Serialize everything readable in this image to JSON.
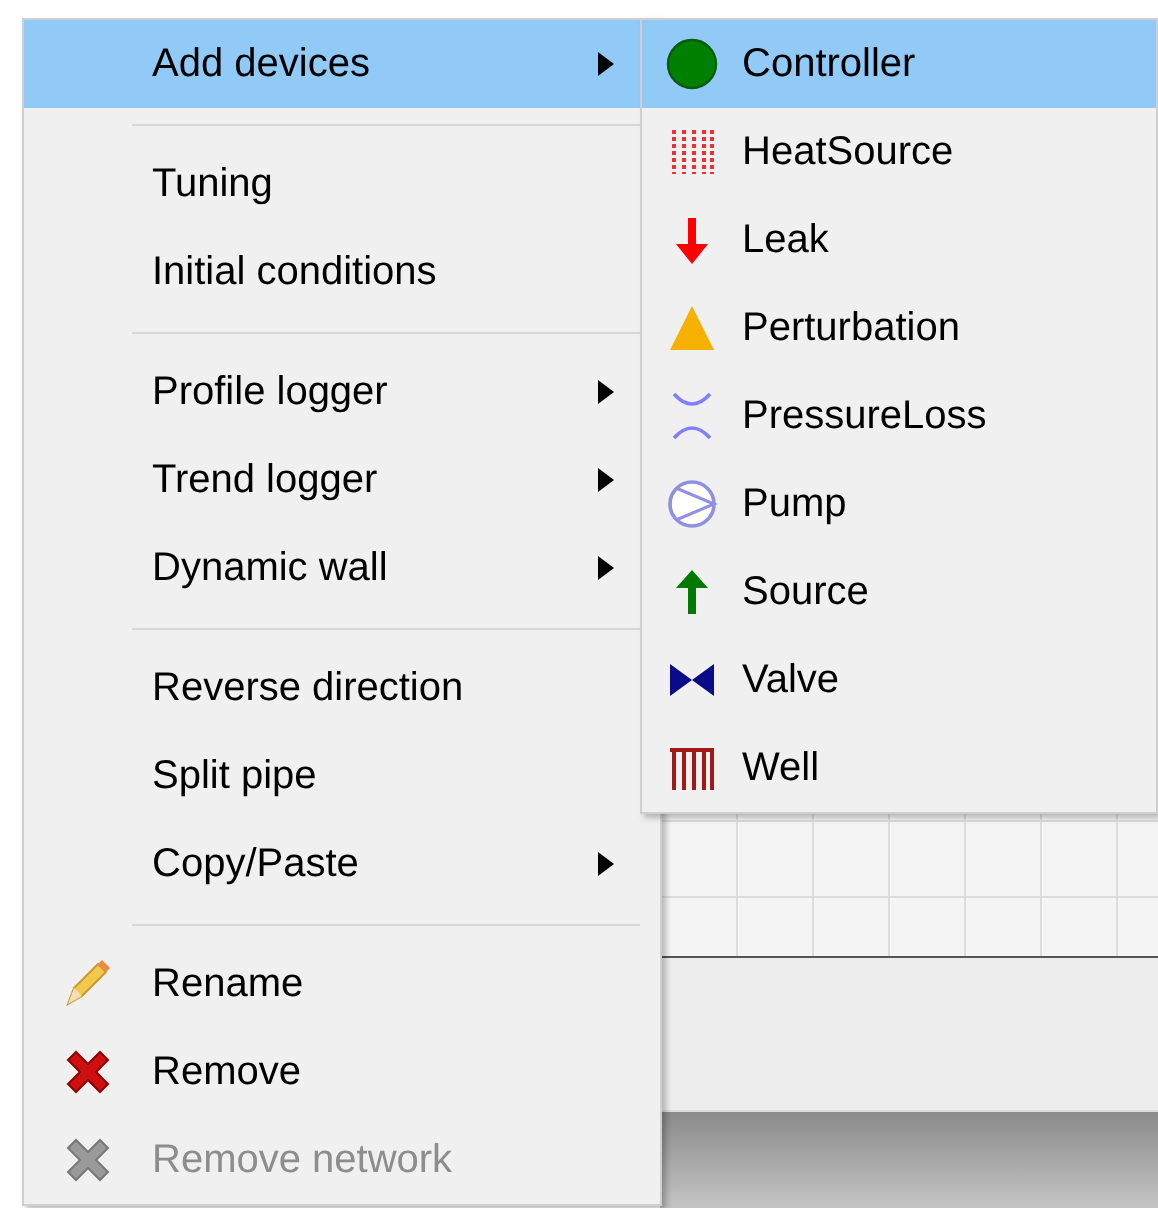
{
  "context_menu": {
    "items": [
      {
        "kind": "item",
        "label": "Add devices",
        "selected": true,
        "has_submenu": true,
        "disabled": false
      },
      {
        "kind": "separator"
      },
      {
        "kind": "item",
        "label": "Tuning",
        "selected": false,
        "has_submenu": false,
        "disabled": false
      },
      {
        "kind": "item",
        "label": "Initial conditions",
        "selected": false,
        "has_submenu": false,
        "disabled": false
      },
      {
        "kind": "separator"
      },
      {
        "kind": "item",
        "label": "Profile logger",
        "selected": false,
        "has_submenu": true,
        "disabled": false
      },
      {
        "kind": "item",
        "label": "Trend logger",
        "selected": false,
        "has_submenu": true,
        "disabled": false
      },
      {
        "kind": "item",
        "label": "Dynamic wall",
        "selected": false,
        "has_submenu": true,
        "disabled": false
      },
      {
        "kind": "separator"
      },
      {
        "kind": "item",
        "label": "Reverse direction",
        "selected": false,
        "has_submenu": false,
        "disabled": false
      },
      {
        "kind": "item",
        "label": "Split pipe",
        "selected": false,
        "has_submenu": false,
        "disabled": false
      },
      {
        "kind": "item",
        "label": "Copy/Paste",
        "selected": false,
        "has_submenu": true,
        "disabled": false
      },
      {
        "kind": "separator"
      },
      {
        "kind": "item",
        "label": "Rename",
        "selected": false,
        "has_submenu": false,
        "disabled": false
      },
      {
        "kind": "item",
        "label": "Remove",
        "selected": false,
        "has_submenu": false,
        "disabled": false
      },
      {
        "kind": "item",
        "label": "Remove network",
        "selected": false,
        "has_submenu": false,
        "disabled": true
      }
    ]
  },
  "devices_submenu": {
    "items": [
      {
        "kind": "item",
        "label": "Controller",
        "selected": true
      },
      {
        "kind": "item",
        "label": "HeatSource",
        "selected": false
      },
      {
        "kind": "item",
        "label": "Leak",
        "selected": false
      },
      {
        "kind": "item",
        "label": "Perturbation",
        "selected": false
      },
      {
        "kind": "item",
        "label": "PressureLoss",
        "selected": false
      },
      {
        "kind": "item",
        "label": "Pump",
        "selected": false
      },
      {
        "kind": "item",
        "label": "Source",
        "selected": false
      },
      {
        "kind": "item",
        "label": "Valve",
        "selected": false
      },
      {
        "kind": "item",
        "label": "Well",
        "selected": false
      }
    ]
  }
}
